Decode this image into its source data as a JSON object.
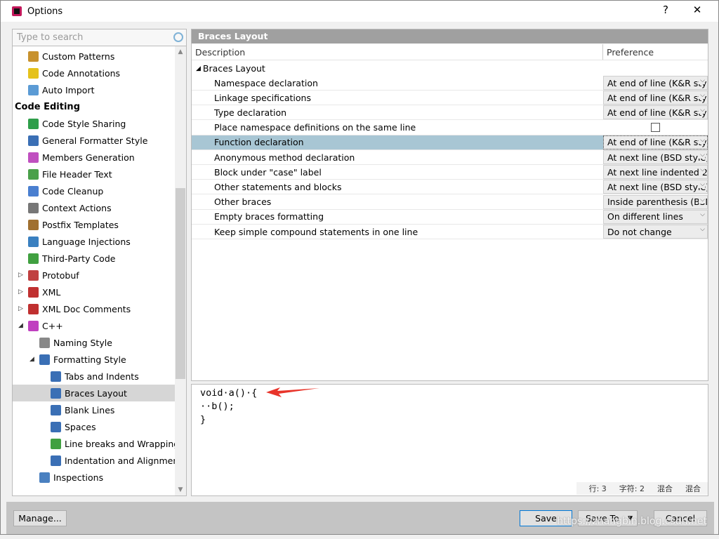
{
  "window": {
    "title": "Options",
    "help": "?",
    "close": "✕"
  },
  "search": {
    "placeholder": "Type to search"
  },
  "tree": [
    {
      "label": "Custom Patterns",
      "level": 1,
      "icon": "custom-patterns-icon",
      "color": "#c8922e"
    },
    {
      "label": "Code Annotations",
      "level": 1,
      "icon": "code-annotations-icon",
      "color": "#e5c21c"
    },
    {
      "label": "Auto Import",
      "level": 1,
      "icon": "filter-icon",
      "color": "#5b9bd5"
    },
    {
      "label": "Code Editing",
      "level": 0,
      "group": true
    },
    {
      "label": "Code Style Sharing",
      "level": 1,
      "icon": "code-style-sharing-icon",
      "color": "#2e9e4a"
    },
    {
      "label": "General Formatter Style",
      "level": 1,
      "icon": "formatter-icon",
      "color": "#3a6fb5"
    },
    {
      "label": "Members Generation",
      "level": 1,
      "icon": "members-generation-icon",
      "color": "#c050c0"
    },
    {
      "label": "File Header Text",
      "level": 1,
      "icon": "file-header-icon",
      "color": "#4aa04a"
    },
    {
      "label": "Code Cleanup",
      "level": 1,
      "icon": "broom-icon",
      "color": "#4a7fd0"
    },
    {
      "label": "Context Actions",
      "level": 1,
      "icon": "hammer-icon",
      "color": "#777777"
    },
    {
      "label": "Postfix Templates",
      "level": 1,
      "icon": "postfix-templates-icon",
      "color": "#a07030"
    },
    {
      "label": "Language Injections",
      "level": 1,
      "icon": "syringe-icon",
      "color": "#3a80c0"
    },
    {
      "label": "Third-Party Code",
      "level": 1,
      "icon": "third-party-code-icon",
      "color": "#40a040"
    },
    {
      "label": "Protobuf",
      "level": 1,
      "icon": "protobuf-icon",
      "color": "#c04040",
      "expander": "collapsed"
    },
    {
      "label": "XML",
      "level": 1,
      "icon": "xml-icon",
      "color": "#c03030",
      "expander": "collapsed"
    },
    {
      "label": "XML Doc Comments",
      "level": 1,
      "icon": "xml-doc-icon",
      "color": "#c03030",
      "expander": "collapsed"
    },
    {
      "label": "C++",
      "level": 1,
      "icon": "cpp-icon",
      "color": "#c040c0",
      "expander": "expanded"
    },
    {
      "label": "Naming Style",
      "level": 2,
      "icon": "naming-style-icon",
      "color": "#888888"
    },
    {
      "label": "Formatting Style",
      "level": 2,
      "icon": "formatter-icon",
      "color": "#3a6fb5",
      "expander": "expanded"
    },
    {
      "label": "Tabs and Indents",
      "level": 3,
      "icon": "tabs-icon",
      "color": "#3a6fb5"
    },
    {
      "label": "Braces Layout",
      "level": 3,
      "icon": "braces-icon",
      "color": "#3a6fb5",
      "selected": true
    },
    {
      "label": "Blank Lines",
      "level": 3,
      "icon": "blank-lines-icon",
      "color": "#3a6fb5"
    },
    {
      "label": "Spaces",
      "level": 3,
      "icon": "spaces-icon",
      "color": "#3a6fb5"
    },
    {
      "label": "Line breaks and Wrapping",
      "level": 3,
      "icon": "wrapping-icon",
      "color": "#40a040"
    },
    {
      "label": "Indentation and Alignment",
      "level": 3,
      "icon": "indentation-icon",
      "color": "#3a6fb5"
    },
    {
      "label": "Inspections",
      "level": 2,
      "icon": "inspections-icon",
      "color": "#4a80c0"
    }
  ],
  "panel": {
    "title": "Braces Layout",
    "columns": {
      "description": "Description",
      "preference": "Preference"
    },
    "group": "Braces Layout",
    "rows": [
      {
        "description": "Namespace declaration",
        "value": "At end of line (K&R style)"
      },
      {
        "description": "Linkage specifications",
        "value": "At end of line (K&R style)"
      },
      {
        "description": "Type declaration",
        "value": "At end of line (K&R style)"
      },
      {
        "description": "Place namespace definitions on the same line",
        "checkbox": true,
        "checked": false
      },
      {
        "description": "Function declaration",
        "value": "At end of line (K&R style)",
        "selected": true
      },
      {
        "description": "Anonymous method declaration",
        "value": "At next line (BSD style)"
      },
      {
        "description": "Block under \"case\" label",
        "value": "At next line indented 2"
      },
      {
        "description": "Other statements and blocks",
        "value": "At next line (BSD style)"
      },
      {
        "description": "Other braces",
        "value": "Inside parenthesis (BSD)"
      },
      {
        "description": "Empty braces formatting",
        "value": "On different lines"
      },
      {
        "description": "Keep simple compound statements in one line",
        "value": "Do not change"
      }
    ]
  },
  "preview": {
    "lines": [
      "void·a()·{",
      "··b();",
      "}"
    ],
    "status": {
      "line": "行: 3",
      "char": "字符: 2",
      "mode1": "混合",
      "mode2": "混合"
    }
  },
  "buttons": {
    "manage": "Manage...",
    "save": "Save",
    "save_to": "Save To",
    "cancel": "Cancel"
  },
  "watermark": "https://zhangbin.blog.csdn.net",
  "colors": {
    "header": "#a0a0a0",
    "selected_row": "#a8c6d4",
    "annotation_arrow": "#e8342a"
  }
}
